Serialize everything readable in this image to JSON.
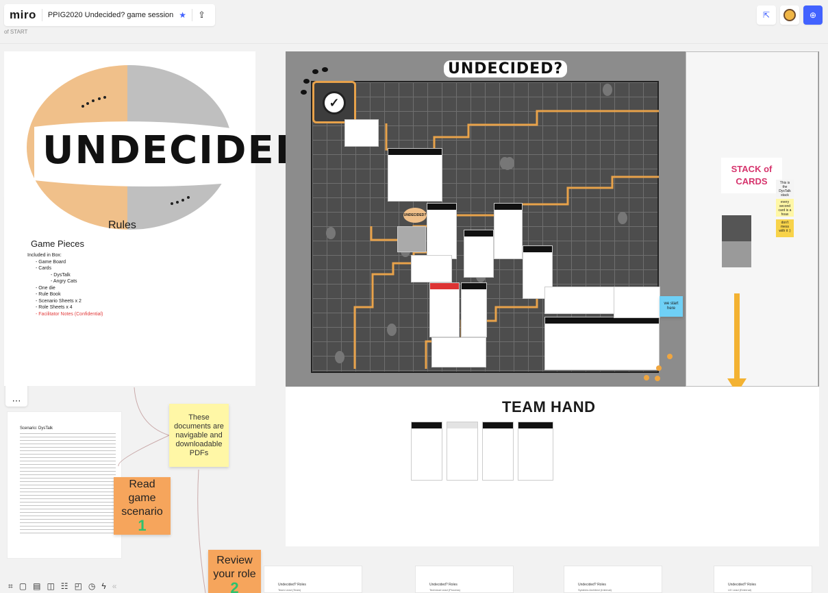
{
  "app": {
    "logo": "miro",
    "board_title": "PPIG2020 Undecided? game session",
    "breadcrumb": "of START"
  },
  "icons": {
    "star": "star-icon",
    "share": "upload-icon",
    "cursor_filter": "cursor-icon",
    "apps": "globe-icon"
  },
  "toolbar": {
    "tools": [
      "select-icon",
      "templates-icon",
      "text-icon",
      "sticky-note-icon",
      "shape-icon",
      "connector-icon",
      "card-icon",
      "pen-icon",
      "comment-icon",
      "frame-icon",
      "upload-icon",
      "more-icon"
    ]
  },
  "rules": {
    "logo_text": "UNDECIDED?",
    "label": "Rules",
    "section_title": "Game Pieces",
    "items": [
      "Included in Box:",
      "-   Game Board",
      "-   Cards",
      "-   DysTalk",
      "-   Angry Cats",
      "-   One die",
      "-   Rule Book",
      "-   Scenario Sheets x 2",
      "-   Role Sheets x 4",
      "-   Facilitator Notes (Confidential)"
    ]
  },
  "board": {
    "title": "UNDECIDED?",
    "stack_label_line1": "STACK of",
    "stack_label_line2": "CARDS",
    "notes": {
      "dystalk": "This is the DysTalk stack",
      "every_second": "every second card is a hoax",
      "dont_mess": "don't mess with it :)",
      "start_here": "we start here"
    }
  },
  "team_hand": {
    "title": "TEAM HAND"
  },
  "scenario": {
    "title": "Scenario: DysTalk"
  },
  "stickies": {
    "docs": "These documents are navigable and downloadable PDFs",
    "read_text": "Read game scenario",
    "read_num": "1",
    "review_text": "Review your role",
    "review_num": "2"
  },
  "roles": [
    {
      "title": "Undecided? Roles",
      "sub": "Team Lead (Team)"
    },
    {
      "title": "Undecided? Roles",
      "sub": "Technical Lead (Process)"
    },
    {
      "title": "Undecided? Roles",
      "sub": "Systems Architect (Internal)"
    },
    {
      "title": "Undecided? Roles",
      "sub": "UX Lead (External)"
    }
  ],
  "bottombar": {
    "tools": [
      "frames-icon",
      "comments-icon",
      "chat-icon",
      "cards-icon",
      "kanban-icon",
      "screen-icon",
      "timer-icon",
      "activity-icon",
      "collapse-icon"
    ]
  },
  "colors": {
    "accent": "#4262ff",
    "sticky_yellow": "#fff7a6",
    "sticky_orange": "#f6a55c",
    "stack_pink": "#d6336c",
    "path_orange": "#e8a24a"
  }
}
